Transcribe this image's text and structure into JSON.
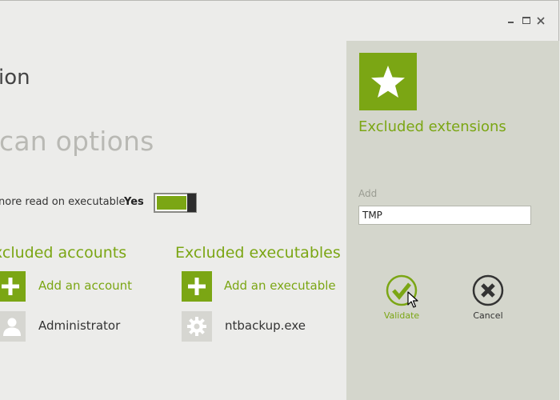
{
  "header": {
    "page_title": "ion",
    "section_title": "can options"
  },
  "window_controls": {
    "minimize_icon": "minimize-icon",
    "maximize_icon": "maximize-icon",
    "close_icon": "close-icon"
  },
  "option": {
    "label": "nore read on executable",
    "value": "Yes",
    "toggle_on": true
  },
  "accounts": {
    "heading": "xcluded accounts",
    "add_label": "Add an account",
    "items": [
      {
        "label": "Administrator",
        "icon": "user-icon"
      }
    ]
  },
  "executables": {
    "heading": "Excluded executables",
    "add_label": "Add an executable",
    "items": [
      {
        "label": "ntbackup.exe",
        "icon": "gear-icon"
      }
    ]
  },
  "panel": {
    "icon": "star-icon",
    "title": "Excluded extensions",
    "add_label": "Add",
    "input_value": "TMP",
    "validate_label": "Validate",
    "cancel_label": "Cancel"
  },
  "colors": {
    "accent": "#7ba614",
    "panel_bg": "#d4d6cc",
    "window_bg": "#ececea"
  }
}
